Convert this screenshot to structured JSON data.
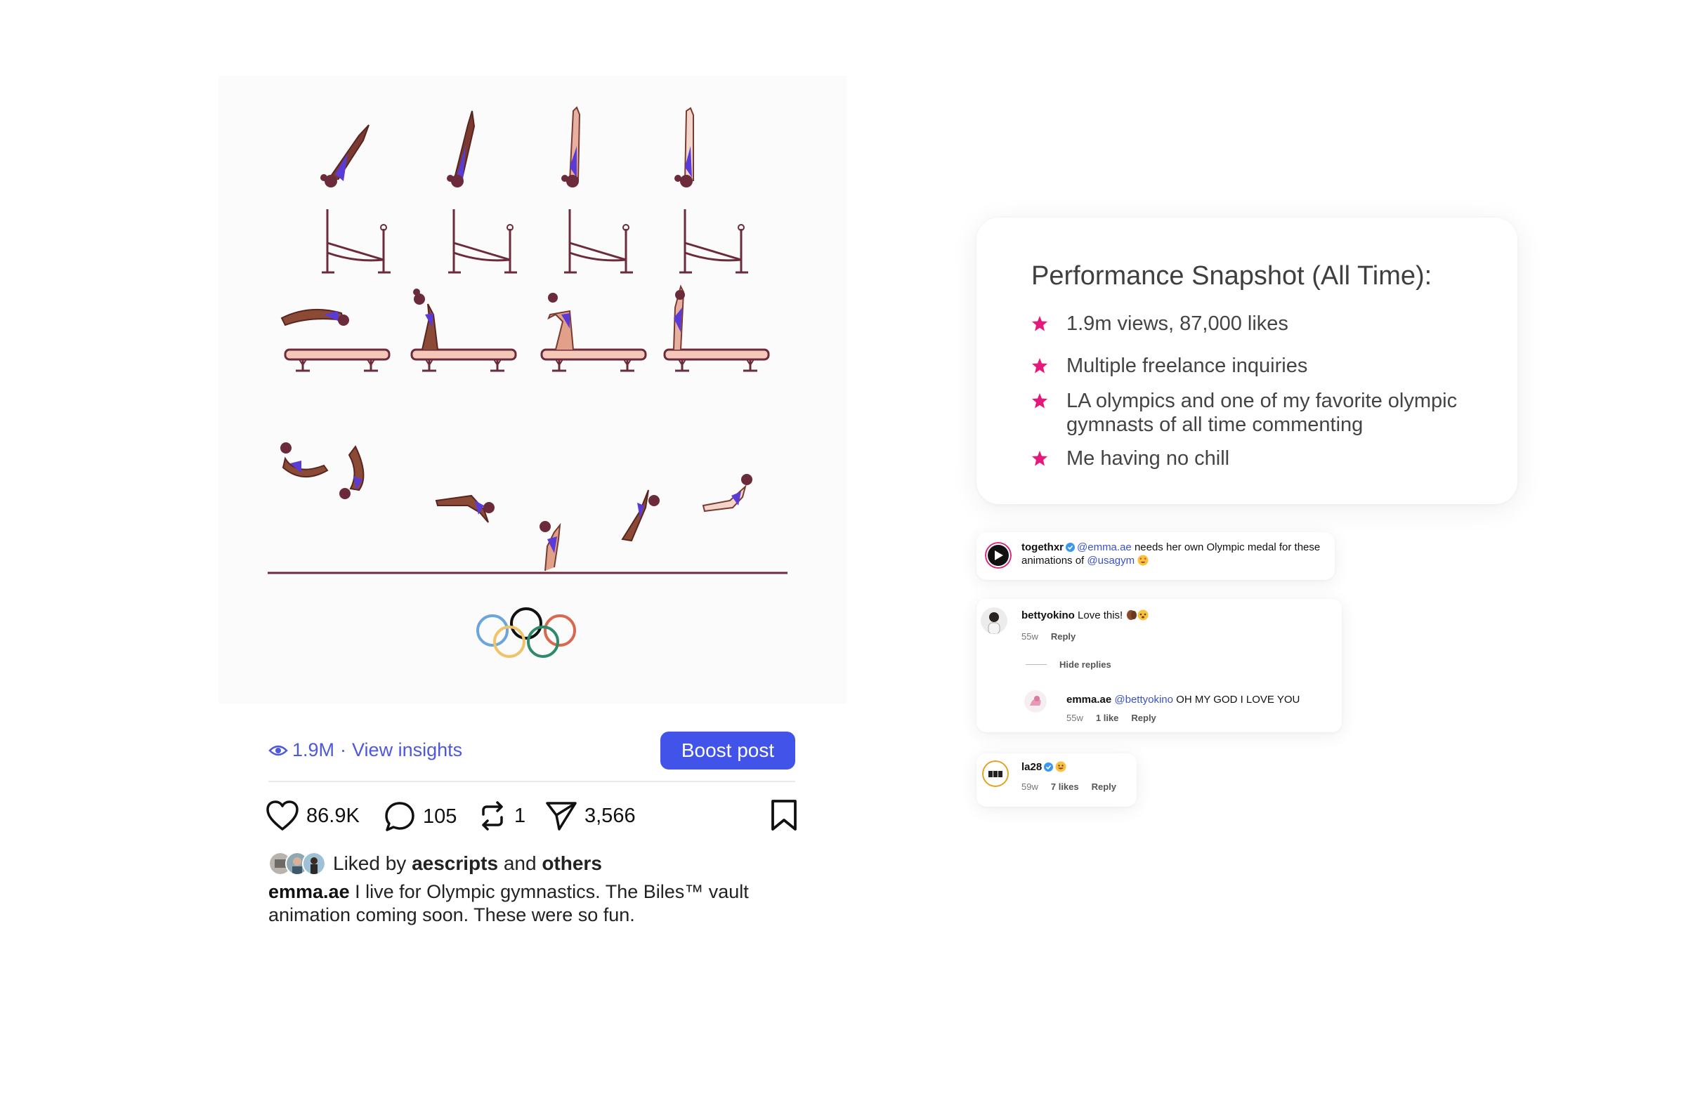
{
  "post": {
    "insights_views": "1.9M",
    "insights_separator": "·",
    "insights_label": "View insights",
    "boost_label": "Boost post",
    "likes": "86.9K",
    "comments": "105",
    "reposts": "1",
    "shares": "3,566",
    "liked_by_prefix": "Liked by",
    "liked_by_user": "aescripts",
    "liked_by_and": "and",
    "liked_by_others": "others",
    "caption_user": "emma.ae",
    "caption_text": "I live for Olympic gymnastics. The Biles™ vault animation coming soon. These were so fun."
  },
  "performance": {
    "title": "Performance Snapshot (All Time):",
    "accent_color": "#e5197b",
    "items": [
      "1.9m views, 87,000 likes",
      "Multiple freelance inquiries",
      "LA olympics and one of my favorite olympic gymnasts of all time commenting",
      "Me having no chill"
    ]
  },
  "comments": [
    {
      "user": "togethxr",
      "mention": "@emma.ae",
      "text_1": "needs her own Olympic medal for these animations of",
      "mention_2": "@usagym"
    },
    {
      "user": "bettyokino",
      "text": "Love this!",
      "time": "55w",
      "reply_label": "Reply",
      "hide_replies_label": "Hide replies",
      "reply": {
        "user": "emma.ae",
        "mention": "@bettyokino",
        "text": "OH MY GOD I LOVE YOU",
        "time": "55w",
        "likes": "1 like",
        "reply_label": "Reply"
      }
    },
    {
      "user": "la28",
      "time": "59w",
      "likes": "7 likes",
      "reply_label": "Reply"
    }
  ],
  "colors": {
    "brand_blue": "#4153e8",
    "link_blue": "#4d59d9",
    "mention_blue": "#3a52c9"
  }
}
